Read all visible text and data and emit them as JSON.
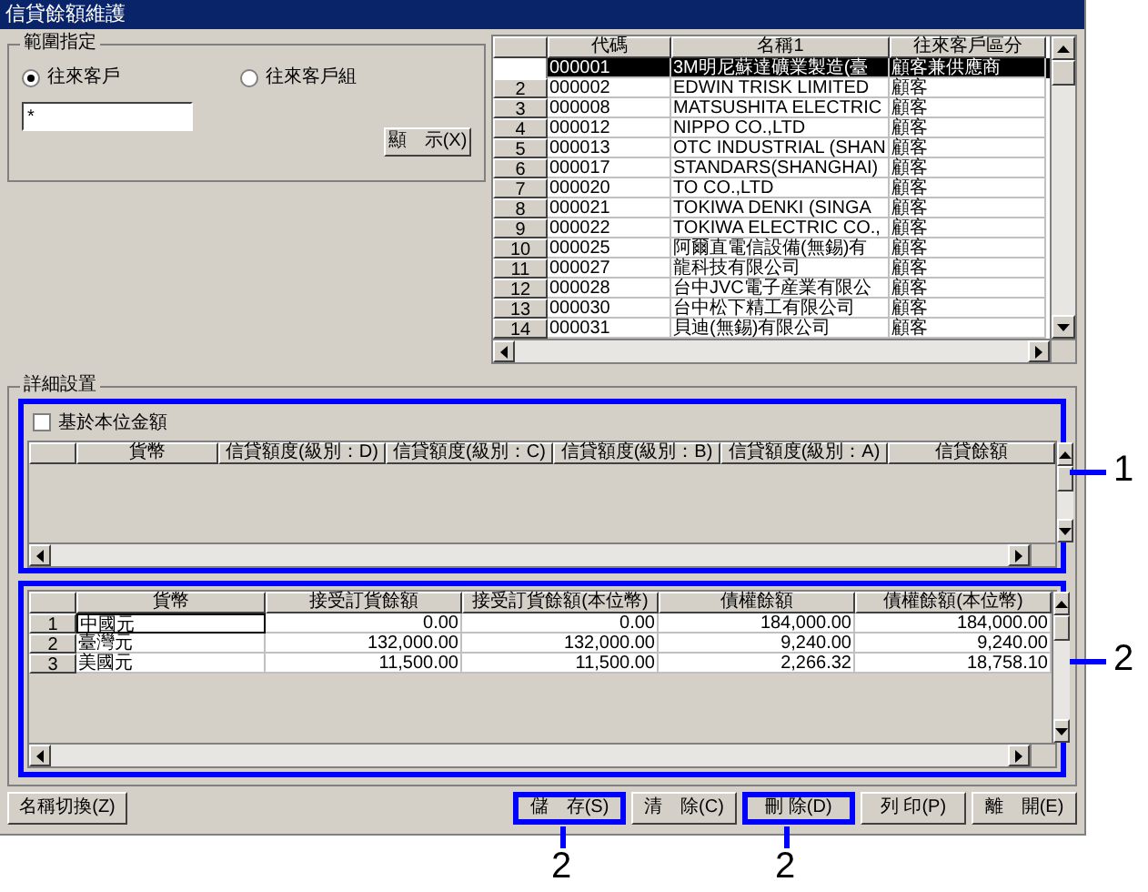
{
  "window": {
    "title": "信貸餘額維護"
  },
  "range_group": {
    "title": "範圍指定",
    "radios": [
      {
        "label": "往來客戶",
        "selected": true
      },
      {
        "label": "往來客戶組",
        "selected": false
      }
    ],
    "input_value": "*",
    "show_button": "顯　示(X)"
  },
  "customer_table": {
    "columns": [
      "代碼",
      "名稱1",
      "往來客戶區分"
    ],
    "rows": [
      {
        "number": "",
        "cells": [
          "000001",
          "3M明尼蘇達礦業製造(臺",
          "顧客兼供應商"
        ],
        "selected": true
      },
      {
        "number": "2",
        "cells": [
          "000002",
          "EDWIN TRISK LIMITED",
          "顧客"
        ],
        "selected": false
      },
      {
        "number": "3",
        "cells": [
          "000008",
          "MATSUSHITA ELECTRIC",
          "顧客"
        ],
        "selected": false
      },
      {
        "number": "4",
        "cells": [
          "000012",
          "NIPPO CO.,LTD",
          "顧客"
        ],
        "selected": false
      },
      {
        "number": "5",
        "cells": [
          "000013",
          "OTC INDUSTRIAL (SHAN",
          "顧客"
        ],
        "selected": false
      },
      {
        "number": "6",
        "cells": [
          "000017",
          "STANDARS(SHANGHAI)",
          "顧客"
        ],
        "selected": false
      },
      {
        "number": "7",
        "cells": [
          "000020",
          "TO CO.,LTD",
          "顧客"
        ],
        "selected": false
      },
      {
        "number": "8",
        "cells": [
          "000021",
          "TOKIWA DENKI (SINGA",
          "顧客"
        ],
        "selected": false
      },
      {
        "number": "9",
        "cells": [
          "000022",
          "TOKIWA ELECTRIC CO.,",
          "顧客"
        ],
        "selected": false
      },
      {
        "number": "10",
        "cells": [
          "000025",
          "阿爾直電信設備(無錫)有",
          "顧客"
        ],
        "selected": false
      },
      {
        "number": "11",
        "cells": [
          "000027",
          "龍科技有限公司",
          "顧客"
        ],
        "selected": false
      },
      {
        "number": "12",
        "cells": [
          "000028",
          "台中JVC電子産業有限公",
          "顧客"
        ],
        "selected": false
      },
      {
        "number": "13",
        "cells": [
          "000030",
          "台中松下精工有限公司",
          "顧客"
        ],
        "selected": false
      },
      {
        "number": "14",
        "cells": [
          "000031",
          "貝迪(無錫)有限公司",
          "顧客"
        ],
        "selected": false
      }
    ]
  },
  "detail_group": {
    "title": "詳細設置",
    "credit_panel": {
      "callout": "1",
      "checkbox": {
        "label": "基於本位金額",
        "checked": false
      },
      "columns": [
        "貨幣",
        "信貸額度(級別：D)",
        "信貸額度(級別：C)",
        "信貸額度(級別：B)",
        "信貸額度(級別：A)",
        "信貸餘額"
      ]
    },
    "balance_table": {
      "callout": "2",
      "columns": [
        "貨幣",
        "接受訂貨餘額",
        "接受訂貨餘額(本位幣)",
        "債權餘額",
        "債權餘額(本位幣)"
      ],
      "rows": [
        {
          "number": "1",
          "cells": [
            "中國元",
            "0.00",
            "0.00",
            "184,000.00",
            "184,000.00"
          ]
        },
        {
          "number": "2",
          "cells": [
            "臺灣元",
            "132,000.00",
            "132,000.00",
            "9,240.00",
            "9,240.00"
          ]
        },
        {
          "number": "3",
          "cells": [
            "美國元",
            "11,500.00",
            "11,500.00",
            "2,266.32",
            "18,758.10"
          ]
        }
      ]
    }
  },
  "buttons": [
    {
      "label": "名稱切換(Z)"
    },
    {
      "label": "儲　存(S)",
      "callout": "2"
    },
    {
      "label": "清　除(C)"
    },
    {
      "label": "刪 除(D)",
      "callout": "2"
    },
    {
      "label": "列 印(P)"
    },
    {
      "label": "離　開(E)"
    }
  ]
}
